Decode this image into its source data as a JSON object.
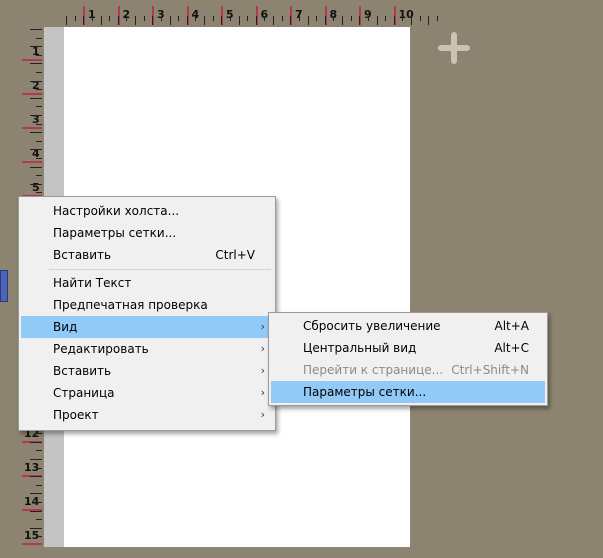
{
  "ruler": {
    "top_labels": [
      "1",
      "2",
      "3",
      "4",
      "5",
      "6",
      "7",
      "8",
      "9",
      "10"
    ],
    "left_labels": [
      "1",
      "2",
      "3",
      "4",
      "5",
      "12",
      "13",
      "14",
      "15"
    ]
  },
  "context_menu": {
    "items": [
      {
        "label": "Настройки холста...",
        "shortcut": ""
      },
      {
        "label": "Параметры сетки...",
        "shortcut": ""
      },
      {
        "label": "Вставить",
        "shortcut": "Ctrl+V"
      },
      {
        "label": "Найти Текст",
        "shortcut": ""
      },
      {
        "label": "Предпечатная проверка",
        "shortcut": ""
      },
      {
        "label": "Вид",
        "shortcut": "",
        "submenu": true,
        "selected": true
      },
      {
        "label": "Редактировать",
        "shortcut": "",
        "submenu": true
      },
      {
        "label": "Вставить",
        "shortcut": "",
        "submenu": true
      },
      {
        "label": "Страница",
        "shortcut": "",
        "submenu": true
      },
      {
        "label": "Проект",
        "shortcut": "",
        "submenu": true
      }
    ]
  },
  "view_submenu": {
    "items": [
      {
        "label": "Сбросить увеличение",
        "shortcut": "Alt+A"
      },
      {
        "label": "Центральный вид",
        "shortcut": "Alt+C"
      },
      {
        "label": "Перейти к странице...",
        "shortcut": "Ctrl+Shift+N",
        "disabled": true
      },
      {
        "label": "Параметры сетки...",
        "shortcut": "",
        "selected": true
      }
    ]
  },
  "colors": {
    "workspace": "#8c8470",
    "selection": "#91c9f7",
    "ruler_mark": "#b23a4a"
  },
  "icons": {
    "add": "plus-icon",
    "submenu": "chevron-right-icon"
  }
}
